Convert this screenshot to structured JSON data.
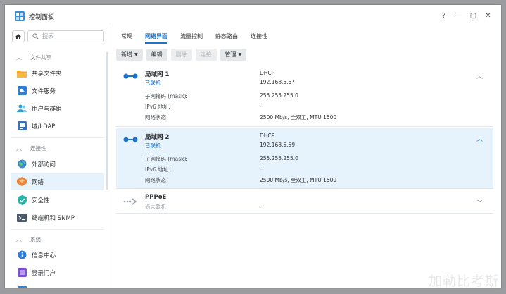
{
  "window": {
    "title": "控制面板"
  },
  "window_controls": {
    "help": "?",
    "minimize": "—",
    "maximize": "▢",
    "close": "✕"
  },
  "search": {
    "placeholder": "搜索",
    "value": ""
  },
  "sidebar": {
    "sections": [
      {
        "label": "文件共享",
        "items": [
          {
            "label": "共享文件夹",
            "icon": "folder-icon"
          },
          {
            "label": "文件服务",
            "icon": "file-services-icon"
          },
          {
            "label": "用户与群组",
            "icon": "users-icon"
          },
          {
            "label": "域/LDAP",
            "icon": "domain-icon"
          }
        ]
      },
      {
        "label": "连接性",
        "items": [
          {
            "label": "外部访问",
            "icon": "globe-icon"
          },
          {
            "label": "网络",
            "icon": "network-icon",
            "active": true
          },
          {
            "label": "安全性",
            "icon": "shield-icon"
          },
          {
            "label": "终端机和 SNMP",
            "icon": "terminal-icon"
          }
        ]
      },
      {
        "label": "系统",
        "items": [
          {
            "label": "信息中心",
            "icon": "info-icon"
          },
          {
            "label": "登录门户",
            "icon": "portal-icon"
          }
        ]
      }
    ]
  },
  "tabs": [
    {
      "label": "常规"
    },
    {
      "label": "网络界面",
      "active": true
    },
    {
      "label": "流量控制"
    },
    {
      "label": "静态路由"
    },
    {
      "label": "连接性"
    }
  ],
  "toolbar": {
    "create": "新增",
    "edit": "编辑",
    "delete": "删除",
    "connect": "连接",
    "manage": "管理"
  },
  "interfaces": [
    {
      "name": "局域网 1",
      "status": "已联机",
      "mode": "DHCP",
      "ip": "192.168.5.57",
      "rows": [
        {
          "label": "子网掩码 (mask):",
          "value": "255.255.255.0"
        },
        {
          "label": "IPv6 地址:",
          "value": "--"
        },
        {
          "label": "网络状态:",
          "value": "2500 Mb/s, 全双工, MTU 1500"
        }
      ]
    },
    {
      "name": "局域网 2",
      "status": "已联机",
      "mode": "DHCP",
      "ip": "192.168.5.59",
      "rows": [
        {
          "label": "子网掩码 (mask):",
          "value": "255.255.255.0"
        },
        {
          "label": "IPv6 地址:",
          "value": "--"
        },
        {
          "label": "网络状态:",
          "value": "2500 Mb/s, 全双工, MTU 1500"
        }
      ]
    },
    {
      "name": "PPPoE",
      "status": "尚未联机",
      "ip": "--"
    }
  ],
  "colors": {
    "accent": "#1e73c8",
    "selected_bg": "#e6f2fc",
    "watermark": "#e8e8e8"
  },
  "watermark": "加勒比考斯"
}
